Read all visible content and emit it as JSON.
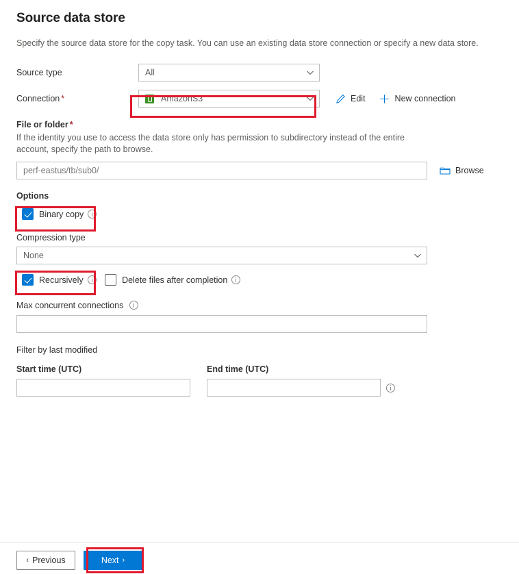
{
  "header": {
    "title": "Source data store",
    "description": "Specify the source data store for the copy task. You can use an existing data store connection or specify a new data store."
  },
  "source_type": {
    "label": "Source type",
    "value": "All",
    "chevron_icon": "chevron-down-icon"
  },
  "connection": {
    "label": "Connection",
    "required_marker": "*",
    "value": "AmazonS3",
    "datastore_icon": "amazon-s3-icon",
    "chevron_icon": "chevron-down-icon",
    "edit_label": "Edit",
    "edit_icon": "pencil-icon",
    "new_connection_label": "New connection",
    "new_connection_icon": "plus-icon",
    "accent_color": "#0078d4"
  },
  "file_or_folder": {
    "label": "File or folder",
    "required_marker": "*",
    "description": "If the identity you use to access the data store only has permission to subdirectory instead of the entire account, specify the path to browse.",
    "value": "perf-eastus/tb/sub0/",
    "browse_label": "Browse",
    "browse_icon": "folder-icon"
  },
  "options": {
    "section_label": "Options",
    "binary_copy": {
      "label": "Binary copy",
      "checked": true,
      "info_icon": "info-icon"
    },
    "compression_type": {
      "label": "Compression type",
      "value": "None",
      "chevron_icon": "chevron-down-icon"
    },
    "recursively": {
      "label": "Recursively",
      "checked": true,
      "info_icon": "info-icon"
    },
    "delete_files": {
      "label": "Delete files after completion",
      "checked": false,
      "info_icon": "info-icon"
    },
    "max_concurrent_connections": {
      "label": "Max concurrent connections",
      "value": "",
      "info_icon": "info-icon"
    }
  },
  "filter": {
    "section_label": "Filter by last modified",
    "start_time_label": "Start time (UTC)",
    "start_time_value": "",
    "end_time_label": "End time (UTC)",
    "end_time_value": "",
    "info_icon": "info-icon"
  },
  "footer": {
    "previous_label": "Previous",
    "previous_arrow": "‹",
    "next_label": "Next",
    "next_arrow": "›"
  },
  "annotations": {
    "highlight_color": "#e01b2e",
    "boxes": [
      {
        "name": "connection-dropdown-highlight"
      },
      {
        "name": "binary-copy-highlight"
      },
      {
        "name": "recursively-highlight"
      },
      {
        "name": "next-button-highlight"
      }
    ]
  }
}
